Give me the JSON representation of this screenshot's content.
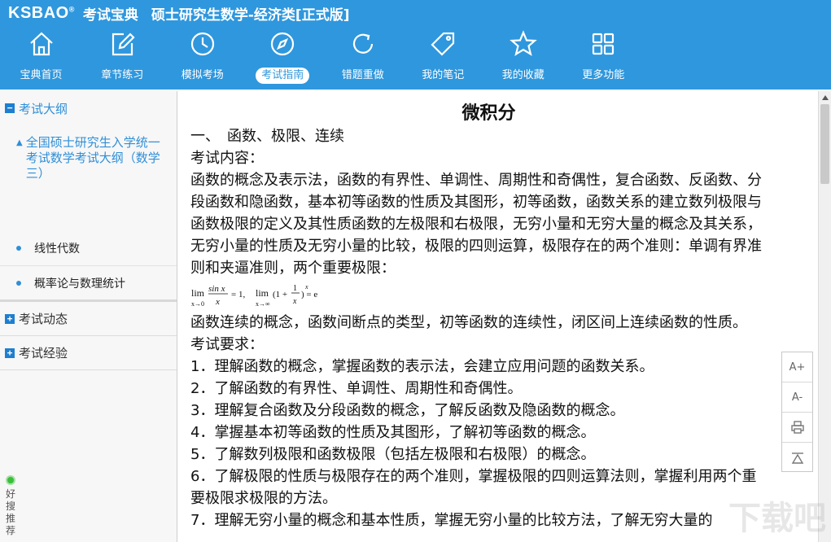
{
  "app": {
    "logo": "KSBAO",
    "logo_reg": "®",
    "logo_cn": "考试宝典",
    "title": "硕士研究生数学-经济类[正式版]"
  },
  "colors": {
    "header": "#2f97dd",
    "accent": "#2f8fd8"
  },
  "nav": [
    {
      "icon": "home-icon",
      "label": "宝典首页"
    },
    {
      "icon": "edit-icon",
      "label": "章节练习"
    },
    {
      "icon": "clock-icon",
      "label": "模拟考场"
    },
    {
      "icon": "compass-icon",
      "label": "考试指南",
      "active": true
    },
    {
      "icon": "refresh-icon",
      "label": "错题重做"
    },
    {
      "icon": "tag-icon",
      "label": "我的笔记"
    },
    {
      "icon": "star-icon",
      "label": "我的收藏"
    },
    {
      "icon": "grid-icon",
      "label": "更多功能"
    }
  ],
  "sidebar": {
    "sections": [
      {
        "toggle": "−",
        "label": "考试大纲"
      },
      {
        "toggle": "+",
        "label": "考试动态"
      },
      {
        "toggle": "+",
        "label": "考试经验"
      }
    ],
    "tree_parent": "全国硕士研究生入学统一考试数学考试大纲（数学三）",
    "leaves": [
      "线性代数",
      "概率论与数理统计"
    ],
    "recommend": [
      "好",
      "搜",
      "推",
      "荐"
    ]
  },
  "content": {
    "title": "微积分",
    "heading": "一、　函数、极限、连续",
    "label_content": "考试内容：",
    "para1": "函数的概念及表示法，函数的有界性、单调性、周期性和奇偶性，复合函数、反函数、分段函数和隐函数，基本初等函数的性质及其图形，初等函数，函数关系的建立数列极限与函数极限的定义及其性质函数的左极限和右极限，无穷小量和无穷大量的概念及其关系，无穷小量的性质及无穷小量的比较，极限的四则运算，极限存在的两个准则：单调有界准则和夹逼准则，两个重要极限：",
    "formula": {
      "lim1": "lim",
      "sub1": "x→0",
      "num1": "sin x",
      "den1": "x",
      "eq1": "= 1,",
      "lim2": "lim",
      "sub2": "x→∞",
      "body2": "(1 +",
      "num2": "1",
      "den2": "x",
      "sup2": "x",
      "eq2": ") = e"
    },
    "para2": "函数连续的概念，函数间断点的类型，初等函数的连续性，闭区间上连续函数的性质。",
    "label_req": "考试要求：",
    "requirements": [
      "1．理解函数的概念，掌握函数的表示法，会建立应用问题的函数关系。",
      "2．了解函数的有界性、单调性、周期性和奇偶性。",
      "3．理解复合函数及分段函数的概念，了解反函数及隐函数的概念。",
      "4．掌握基本初等函数的性质及其图形，了解初等函数的概念。",
      "5．了解数列极限和函数极限（包括左极限和右极限）的概念。",
      "6．了解极限的性质与极限存在的两个准则，掌握极限的四则运算法则，掌握利用两个重要极限求极限的方法。",
      "7．理解无穷小量的概念和基本性质，掌握无穷小量的比较方法，了解无穷大量的"
    ]
  },
  "tools": {
    "font_up": "A+",
    "font_down": "A-",
    "print": "print-icon",
    "top": "back-to-top-icon"
  },
  "watermark": "下载吧"
}
